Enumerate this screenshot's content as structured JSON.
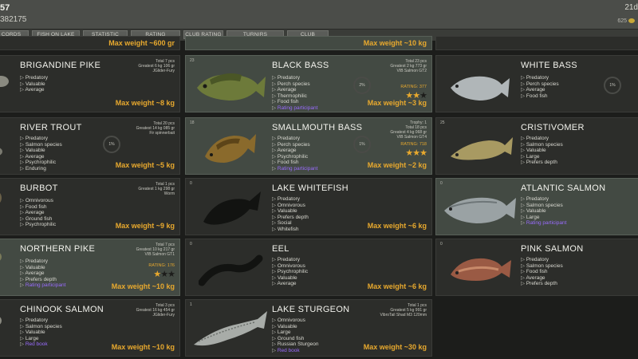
{
  "header": {
    "title": "57",
    "subtitle": "382175",
    "date": "21d",
    "counter": "625"
  },
  "tabs": [
    {
      "label": "CORDS"
    },
    {
      "label": "FISH ON LAKE"
    },
    {
      "label": "STATISTIC"
    },
    {
      "label": "RATING"
    },
    {
      "label": "CLUB RATING"
    },
    {
      "label": "TURNIRS"
    },
    {
      "label": "CLUB"
    }
  ],
  "top_strip": {
    "maxw": "Max weight ~600 gr",
    "maxw2": "Max weight ~10 kg"
  },
  "cards": {
    "brigandine_pike": {
      "name": "BRIGANDINE PIKE",
      "stats": [
        "Total 7 pcs",
        "Greatest 6 kg 106 gr",
        "JGlider-Fury"
      ],
      "tags": [
        "Predatory",
        "Valuable",
        "Average"
      ],
      "maxw": "Max weight ~8 kg"
    },
    "black_bass": {
      "name": "BLACK BASS",
      "mini": "23",
      "stats": [
        "Total 23 pcs",
        "Greatest 2 kg 773 gr",
        "VIB Salmon GT2"
      ],
      "tags": [
        "Predatory",
        "Perch species",
        "Average",
        "Thermophilic",
        "Food fish"
      ],
      "participant": "Rating participant",
      "pct": "2%",
      "rating": "RATING: 377",
      "stars_on": 2,
      "maxw": "Max weight ~3 kg"
    },
    "white_bass": {
      "name": "WHITE BASS",
      "tags": [
        "Predatory",
        "Perch species",
        "Average",
        "Food fish"
      ],
      "pct": "1%"
    },
    "river_trout": {
      "name": "RIVER TROUT",
      "stats": [
        "Total 20 pcs",
        "Greatest 14 kg 085 gr",
        "Fir spinnerbait"
      ],
      "tags": [
        "Predatory",
        "Salmon species",
        "Valuable",
        "Average",
        "Psychrophilic",
        "Enduring"
      ],
      "pct": "1%",
      "maxw": "Max weight ~5 kg"
    },
    "smallmouth_bass": {
      "name": "SMALLMOUTH BASS",
      "mini": "18",
      "stats": [
        "Trophy: 1",
        "Total 18 pcs",
        "Greatest 4 kg 068 gr",
        "VIB Salmon GT4"
      ],
      "tags": [
        "Predatory",
        "Perch species",
        "Average",
        "Psychrophilic",
        "Food fish"
      ],
      "participant": "Rating participant",
      "pct": "1%",
      "rating": "RATING: 718",
      "stars_on": 3,
      "maxw": "Max weight ~2 kg"
    },
    "cristivomer": {
      "name": "CRISTIVOMER",
      "mini": "25",
      "tags": [
        "Predatory",
        "Salmon species",
        "Valuable",
        "Large",
        "Prefers depth"
      ]
    },
    "burbot": {
      "name": "BURBOT",
      "stats": [
        "Total 1 pcs",
        "Greatest 1 kg 298 gr",
        "Worm"
      ],
      "tags": [
        "Omnivorous",
        "Food fish",
        "Average",
        "Ground fish",
        "Psychrophilic"
      ],
      "maxw": "Max weight ~9 kg"
    },
    "lake_whitefish": {
      "name": "LAKE WHITEFISH",
      "mini": "0",
      "tags": [
        "Predatory",
        "Omnivorous",
        "Valuable",
        "Prefers depth",
        "Social",
        "Whitefish"
      ],
      "maxw": "Max weight ~6 kg"
    },
    "atlantic_salmon": {
      "name": "ATLANTIC SALMON",
      "mini": "0",
      "tags": [
        "Predatory",
        "Salmon species",
        "Valuable",
        "Large"
      ],
      "participant": "Rating participant"
    },
    "northern_pike": {
      "name": "NORTHERN PIKE",
      "stats": [
        "Total 7 pcs",
        "Greatest 10 kg 217 gr",
        "VIB Salmon GT1"
      ],
      "tags": [
        "Predatory",
        "Valuable",
        "Average",
        "Prefers depth"
      ],
      "participant": "Rating participant",
      "rating": "RATING: 176",
      "stars_on": 1,
      "maxw": "Max weight ~10 kg"
    },
    "eel": {
      "name": "EEL",
      "mini": "0",
      "tags": [
        "Predatory",
        "Omnivorous",
        "Psychrophilic",
        "Valuable",
        "Average"
      ],
      "maxw": "Max weight ~6 kg"
    },
    "pink_salmon": {
      "name": "PINK SALMON",
      "mini": "0",
      "tags": [
        "Predatory",
        "Salmon species",
        "Food fish",
        "Average",
        "Prefers depth"
      ]
    },
    "chinook_salmon": {
      "name": "CHINOOK SALMON",
      "stats": [
        "Total 3 pcs",
        "Greatest 16 kg 454 gr",
        "JGlider-Fury"
      ],
      "tags": [
        "Predatory",
        "Salmon species",
        "Valuable",
        "Large"
      ],
      "redbook": "Red book",
      "maxw": "Max weight ~10 kg"
    },
    "lake_sturgeon": {
      "name": "LAKE STURGEON",
      "mini": "1",
      "stats": [
        "Total 1 pcs",
        "Greatest 5 kg 991 gr",
        "VibroTail Shad M3 120mm"
      ],
      "tags": [
        "Omnivorous",
        "Valuable",
        "Large",
        "Ground fish",
        "Russian Sturgeon"
      ],
      "redbook": "Red book",
      "maxw": "Max weight ~30 kg"
    }
  }
}
